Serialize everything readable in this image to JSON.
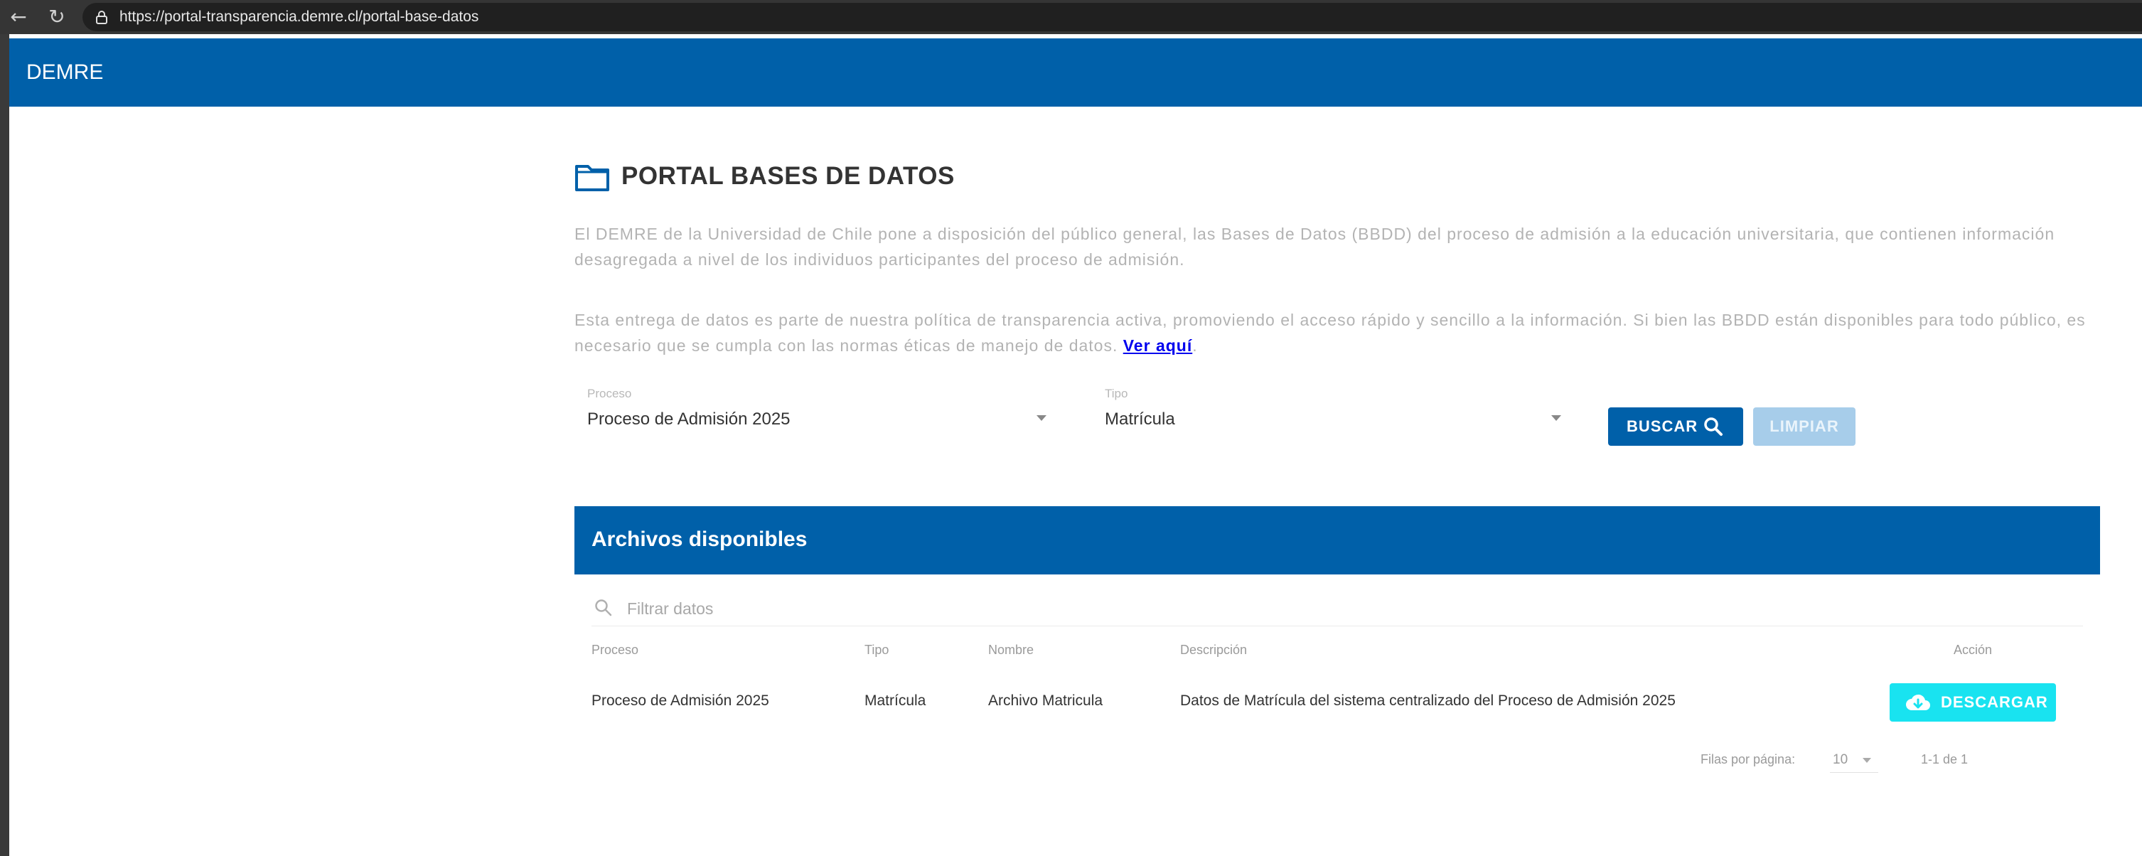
{
  "browser": {
    "url": "https://portal-transparencia.demre.cl/portal-base-datos"
  },
  "header": {
    "brand": "DEMRE"
  },
  "page": {
    "title": "PORTAL BASES DE DATOS",
    "paragraph1": "El DEMRE de la Universidad de Chile pone a disposición del público general, las Bases de Datos (BBDD) del proceso de admisión a la educación universitaria, que contienen información desagregada a nivel de los individuos participantes del proceso de admisión.",
    "paragraph2": "Esta entrega de datos es parte de nuestra política de transparencia activa, promoviendo el acceso rápido y sencillo a la información. Si bien las BBDD están disponibles para todo público, es necesario que se cumpla con las normas éticas de manejo de datos.",
    "link": "Ver aquí",
    "link_suffix": "."
  },
  "filters": {
    "proceso_label": "Proceso",
    "proceso_value": "Proceso de Admisión 2025",
    "tipo_label": "Tipo",
    "tipo_value": "Matrícula",
    "buscar": "BUSCAR",
    "limpiar": "LIMPIAR"
  },
  "table": {
    "title": "Archivos disponibles",
    "filter_placeholder": "Filtrar datos",
    "columns": [
      "Proceso",
      "Tipo",
      "Nombre",
      "Descripción",
      "Acción"
    ],
    "rows": [
      {
        "proceso": "Proceso de Admisión 2025",
        "tipo": "Matrícula",
        "nombre": "Archivo Matricula",
        "descripcion": "Datos de Matrícula del sistema centralizado del Proceso de Admisión 2025",
        "accion": "DESCARGAR"
      }
    ],
    "rows_per_page_label": "Filas por página:",
    "rows_per_page": "10",
    "range": "1-1 de 1"
  },
  "colors": {
    "primary": "#0060a9",
    "download": "#19e3f0",
    "limpiar": "#a7cdea"
  },
  "icons": [
    "back-arrow-icon",
    "reload-icon",
    "lock-icon",
    "folder-icon",
    "search-icon",
    "cloud-download-icon",
    "chevron-down-icon"
  ]
}
